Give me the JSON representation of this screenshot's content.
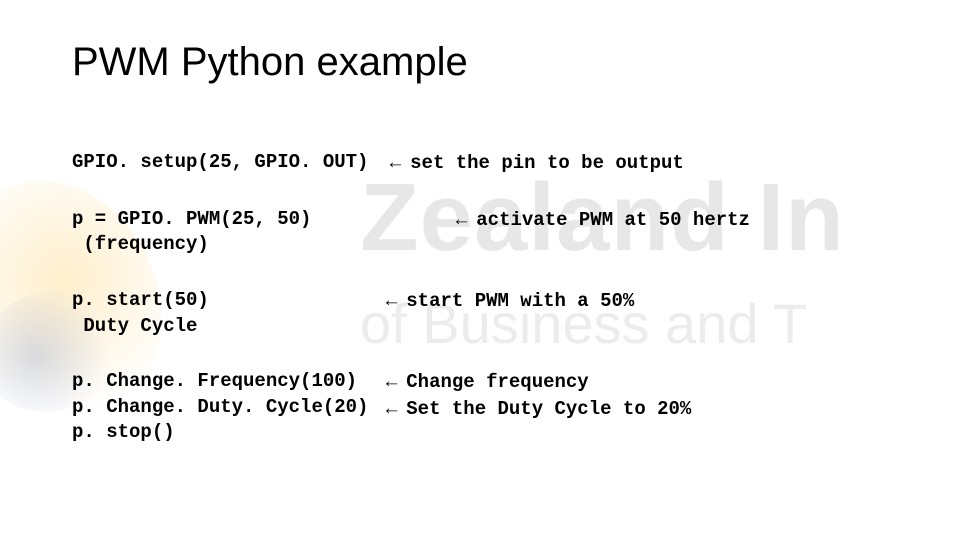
{
  "title": "PWM Python example",
  "arrow": "← ",
  "watermark": {
    "line1": "Zealand In",
    "line2": "of Business and T"
  },
  "rows": [
    {
      "code": "GPIO. setup(25, GPIO. OUT) ",
      "note": "set the pin to be output"
    },
    {
      "code_line1": "p = GPIO. PWM(25, 50)",
      "code_line2": " (frequency)",
      "note": "activate PWM at 50 hertz"
    },
    {
      "code_line1": "p. start(50)",
      "code_line2": " Duty Cycle",
      "note": "start PWM with a 50%"
    },
    {
      "code_line1": "p. Change. Frequency(100)",
      "code_line2": "p. Change. Duty. Cycle(20)",
      "code_line3": "p. stop()",
      "note_line1": "Change frequency",
      "note_line2": "Set the Duty Cycle to 20%"
    }
  ]
}
